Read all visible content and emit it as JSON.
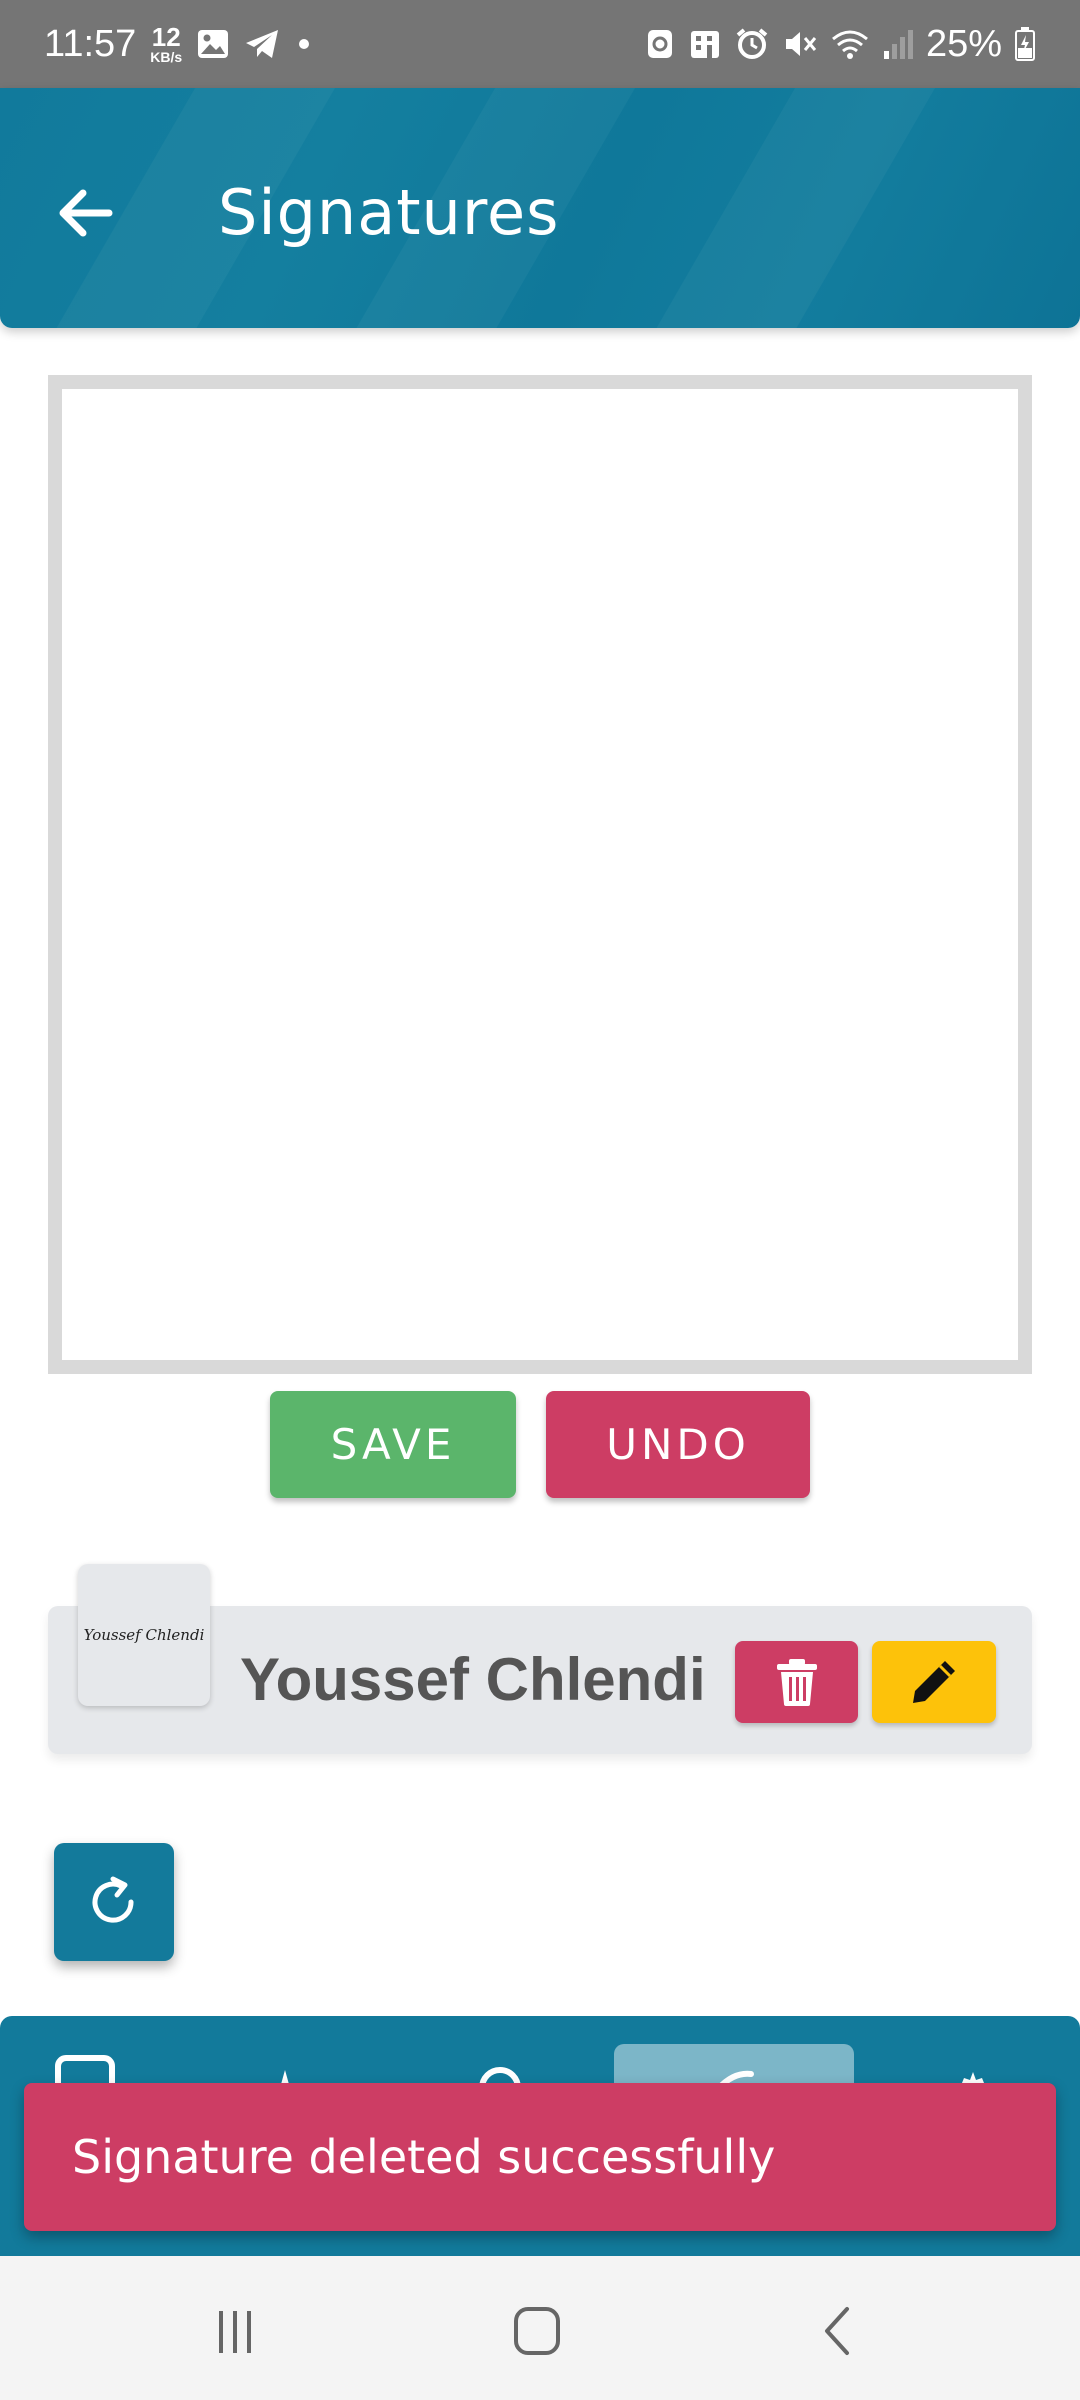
{
  "status_bar": {
    "time": "11:57",
    "network_speed_value": "12",
    "network_speed_unit": "KB/s",
    "battery_percent": "25%",
    "icons_left": [
      "gallery-icon",
      "telegram-icon",
      "notification-dot-icon"
    ],
    "icons_right": [
      "recycle-icon",
      "building-icon",
      "alarm-icon",
      "mute-icon",
      "wifi-icon",
      "signal-icon",
      "battery-charging-icon"
    ]
  },
  "app_bar": {
    "title": "Signatures",
    "back_icon": "arrow-left-icon"
  },
  "signature_pad": {
    "actions": {
      "save_label": "SAVE",
      "undo_label": "UNDO"
    }
  },
  "saved_signatures": [
    {
      "name": "Youssef Chlendi",
      "thumbnail_text": "Youssef Chlendi",
      "delete_icon": "trash-icon",
      "edit_icon": "pencil-icon"
    }
  ],
  "refresh_icon": "refresh-icon",
  "bottom_nav": {
    "items": [
      "document-icon",
      "stamp-icon",
      "search-icon",
      "signature-icon",
      "settings-icon"
    ],
    "active_index": 3
  },
  "snackbar": {
    "message": "Signature deleted successfully"
  },
  "colors": {
    "primary": "#127a9b",
    "success": "#5bb56b",
    "danger": "#cd3d64",
    "warning": "#fdc20a",
    "status_bar": "#757575"
  }
}
